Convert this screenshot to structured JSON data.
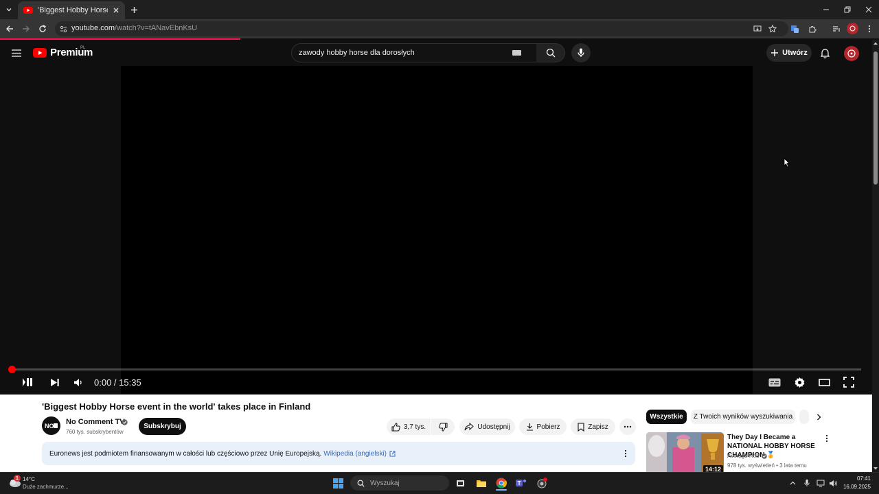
{
  "browser": {
    "tab_title": "'Biggest Hobby Horse event in",
    "url_host": "youtube.com",
    "url_path": "/watch?v=tANavEbnKsU"
  },
  "masthead": {
    "logo_text": "Premium",
    "logo_country": "PL",
    "search_value": "zawody hobby horse dla dorosłych",
    "create_label": "Utwórz"
  },
  "player": {
    "time": "0:00 / 15:35",
    "progress_fraction": 0
  },
  "video": {
    "title": "'Biggest Hobby Horse event in the world' takes place in Finland",
    "channel_name": "No Comment TV",
    "channel_avatar_text": "NO COMMENT",
    "subscribers": "760 tys. subskrybentów",
    "subscribe_label": "Subskrybuj",
    "likes": "3,7 tys.",
    "share_label": "Udostępnij",
    "download_label": "Pobierz",
    "save_label": "Zapisz",
    "info_text": "Euronews jest podmiotem finansowanym w całości lub częściowo przez Unię Europejską.",
    "info_link": "Wikipedia (angielski)"
  },
  "sidebar": {
    "chip_all": "Wszystkie",
    "chip_search": "Z Twoich wyników wyszukiwania",
    "rec_title": "They Day I Became a NATIONAL HOBBY HORSE CHAMPION 🏅",
    "rec_channel": "Average Rob",
    "rec_meta": "978 tys. wyświetleń • 3 lata temu",
    "rec_duration": "14:12"
  },
  "taskbar": {
    "weather_temp": "14°C",
    "weather_desc": "Duże zachmurze...",
    "weather_badge": "1",
    "search_placeholder": "Wyszukaj",
    "clock_time": "07:41",
    "clock_date": "16.09.2025"
  },
  "colors": {
    "youtube_red": "#ff0000",
    "load_bar": "#ff0f4f",
    "info_banner": "#e8f1fa",
    "link_blue": "#3868b8"
  }
}
